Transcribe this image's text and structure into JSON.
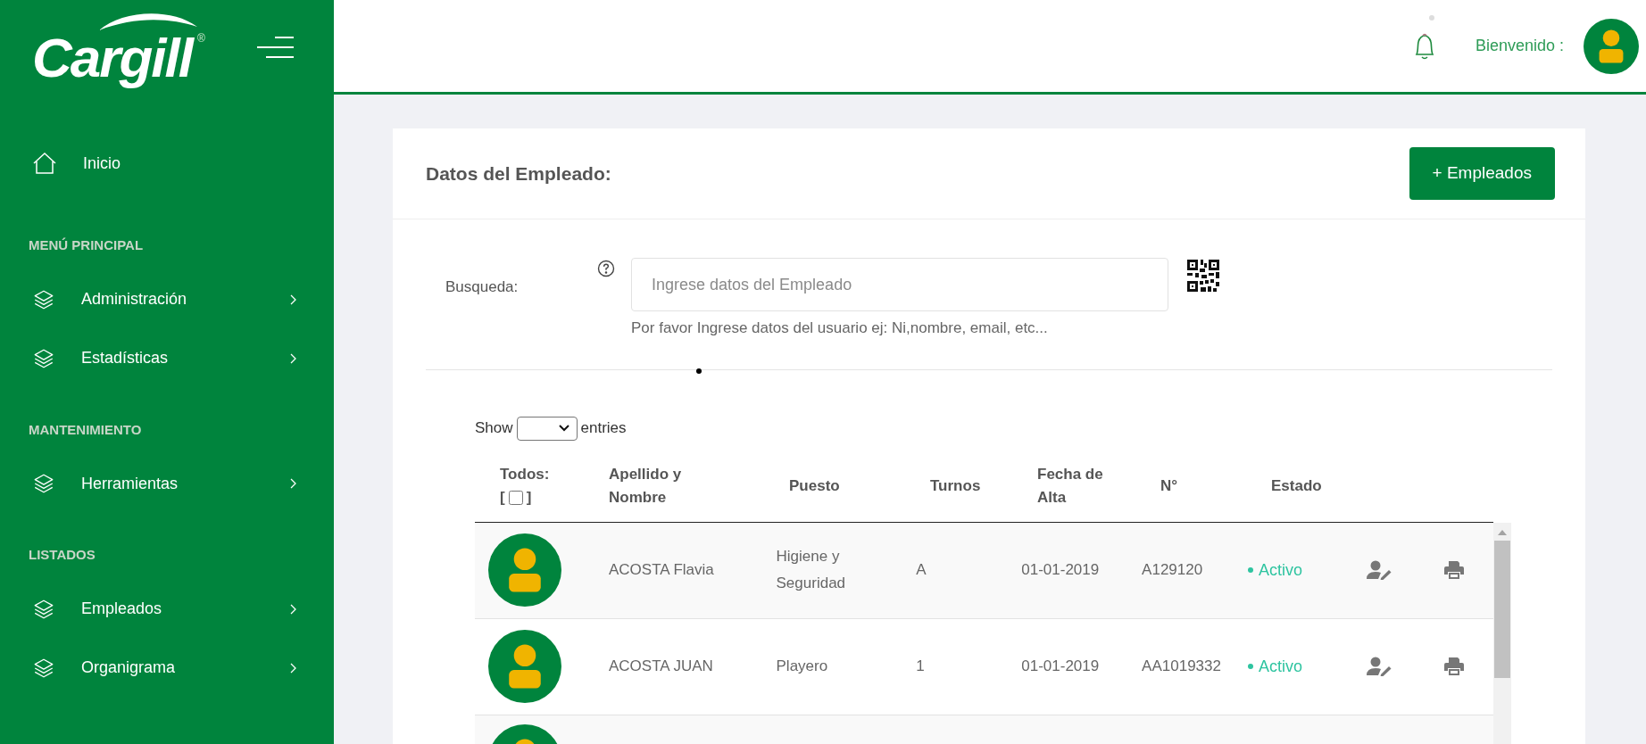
{
  "sidebar": {
    "logo": "Cargill",
    "logo_mark": "®",
    "items": [
      {
        "kind": "home",
        "label": "Inicio"
      },
      {
        "kind": "section",
        "label": "MENÚ PRINCIPAL"
      },
      {
        "kind": "menu",
        "label": "Administración"
      },
      {
        "kind": "menu",
        "label": "Estadísticas"
      },
      {
        "kind": "section",
        "label": "MANTENIMIENTO"
      },
      {
        "kind": "menu",
        "label": "Herramientas"
      },
      {
        "kind": "section",
        "label": "LISTADOS"
      },
      {
        "kind": "menu",
        "label": "Empleados"
      },
      {
        "kind": "menu",
        "label": "Organigrama"
      }
    ]
  },
  "header": {
    "greeting": "Bienvenido :"
  },
  "card": {
    "title": "Datos del Empleado:",
    "add_button": "+ Empleados",
    "search": {
      "label": "Busqueda:",
      "placeholder": "Ingrese datos del Empleado",
      "hint": "Por favor Ingrese datos del usuario ej: Ni,nombre, email, etc..."
    },
    "length": {
      "before": "Show",
      "after": "entries"
    },
    "table": {
      "select_all": {
        "label": "Todos:",
        "open": "[",
        "close": "]",
        "checked": false
      },
      "columns": [
        "Apellido y Nombre",
        "Puesto",
        "Turnos",
        "Fecha de Alta",
        "N°",
        "Estado"
      ],
      "rows": [
        {
          "name": "ACOSTA Flavia",
          "puesto": "Higiene y Seguridad",
          "turno": "A",
          "fecha": "01-01-2019",
          "numero": "A129120",
          "estado": "Activo",
          "color": "#2ec4a0"
        },
        {
          "name": "ACOSTA JUAN",
          "puesto": "Playero",
          "turno": "1",
          "fecha": "01-01-2019",
          "numero": "AA1019332",
          "estado": "Activo",
          "color": "#2ec4a0"
        }
      ]
    }
  }
}
